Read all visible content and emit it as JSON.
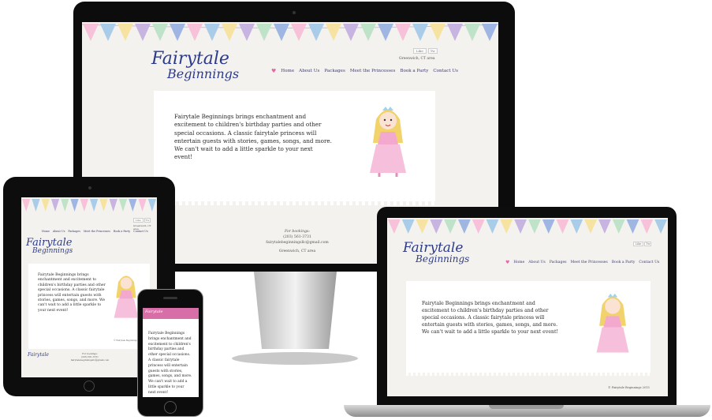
{
  "site": {
    "logo_line1": "Fairytale",
    "logo_line2": "Beginnings",
    "location_header": "Greenwich, CT area",
    "util_buttons": [
      "Like",
      "Tw"
    ],
    "nav": [
      "Home",
      "About Us",
      "Packages",
      "Meet the Princesses",
      "Book a Party",
      "Contact Us"
    ],
    "intro": "Fairytale Beginnings brings enchantment and excitement to children's birthday parties and other special occasions. A classic fairytale princess will entertain guests with stories, games, songs, and more. We can't wait to add a little sparkle to your next event!",
    "footer": {
      "for_bookings": "For bookings:",
      "phone": "(203) 561-3731",
      "email": "fairytalebeginningsllc@gmail.com",
      "area": "Greenwich, CT area",
      "copyright": "© Fairytale Beginnings 2015"
    }
  },
  "colors": {
    "logo": "#2c3a8c",
    "nav_heart": "#e36aa6",
    "phone_header": "#d86ea8",
    "panel": "#ffffff",
    "page_bg": "#f4f2ee"
  },
  "icons": [
    "heart-icon",
    "princess-illustration",
    "bunting-flags",
    "castle-logo-icon"
  ]
}
